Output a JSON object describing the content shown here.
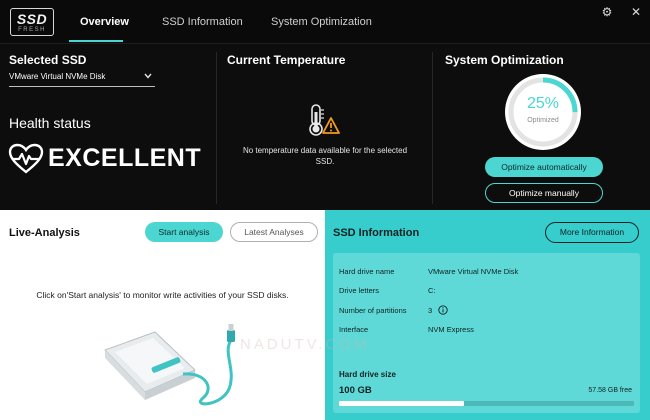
{
  "app": {
    "logo_main": "SSD",
    "logo_sub": "FRESH"
  },
  "nav": {
    "tabs": [
      {
        "label": "Overview",
        "active": true
      },
      {
        "label": "SSD Information",
        "active": false
      },
      {
        "label": "System Optimization",
        "active": false
      }
    ]
  },
  "window": {
    "settings_icon": "gear-icon",
    "close_icon": "close-icon",
    "close_glyph": "✕",
    "settings_glyph": "⚙"
  },
  "selected_ssd": {
    "title": "Selected SSD",
    "value": "VMware Virtual NVMe Disk",
    "health_label": "Health status",
    "health_value": "EXCELLENT"
  },
  "temperature": {
    "title": "Current Temperature",
    "message": "No temperature data available for the selected SSD."
  },
  "optimization": {
    "title": "System Optimization",
    "percent_label": "25%",
    "percent": 25,
    "sub_label": "Optimized",
    "auto_button": "Optimize automatically",
    "manual_button": "Optimize manually"
  },
  "live_analysis": {
    "title": "Live-Analysis",
    "start_button": "Start analysis",
    "latest_button": "Latest Analyses",
    "message": "Click on'Start analysis' to monitor write activities of your SSD disks."
  },
  "ssd_info": {
    "title": "SSD Information",
    "more_button": "More Information",
    "rows": [
      {
        "label": "Hard drive name",
        "value": "VMware Virtual NVMe Disk"
      },
      {
        "label": "Drive letters",
        "value": "C:"
      },
      {
        "label": "Number of partitions",
        "value": "3"
      },
      {
        "label": "Interface",
        "value": "NVM Express"
      }
    ],
    "size_label": "Hard drive size",
    "size_total": "100 GB",
    "size_free": "57.58 GB free",
    "used_fraction": 0.4242
  },
  "colors": {
    "accent": "#4bd6d2",
    "panel_teal": "#36cdcc",
    "warning": "#f39a1a"
  },
  "watermark": "NADUTV.COM"
}
